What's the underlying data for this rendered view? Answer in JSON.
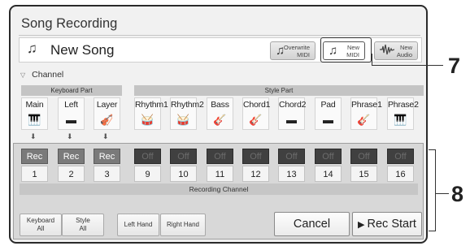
{
  "window": {
    "title": "Song Recording"
  },
  "song": {
    "note_icon": "♫",
    "name": "New Song"
  },
  "mode_buttons": [
    {
      "name": "overwrite-midi-button",
      "icon": "♫",
      "label_line1": "Overwrite",
      "label_line2": "MIDI",
      "selected": false
    },
    {
      "name": "new-midi-button",
      "icon": "♫",
      "label_line1": "New",
      "label_line2": "MIDI",
      "selected": true
    },
    {
      "name": "new-audio-button",
      "icon": "waveform-icon",
      "label_line1": "New",
      "label_line2": "Audio",
      "selected": false
    }
  ],
  "channel": {
    "toggle_icon": "▽",
    "label": "Channel"
  },
  "groups": {
    "keyboard_part": "Keyboard Part",
    "style_part": "Style Part"
  },
  "parts": [
    {
      "name": "Main",
      "icon": "grand-piano-icon",
      "glyph": "🎹"
    },
    {
      "name": "Left",
      "icon": "keyboard-icon",
      "glyph": "▬"
    },
    {
      "name": "Layer",
      "icon": "violin-icon",
      "glyph": "🎻"
    },
    {
      "name": "Rhythm1",
      "icon": "drums-icon",
      "glyph": "🥁"
    },
    {
      "name": "Rhythm2",
      "icon": "drums-icon",
      "glyph": "🥁"
    },
    {
      "name": "Bass",
      "icon": "bass-guitar-icon",
      "glyph": "🎸"
    },
    {
      "name": "Chord1",
      "icon": "guitar-icon",
      "glyph": "🎸"
    },
    {
      "name": "Chord2",
      "icon": "keyboard-icon",
      "glyph": "▬"
    },
    {
      "name": "Pad",
      "icon": "keyboard-icon",
      "glyph": "▬"
    },
    {
      "name": "Phrase1",
      "icon": "guitar-icon",
      "glyph": "🎸"
    },
    {
      "name": "Phrase2",
      "icon": "grand-piano-icon",
      "glyph": "🎹"
    }
  ],
  "arrow_glyph": "⬇",
  "channels": [
    {
      "status": "Rec",
      "number": "1"
    },
    {
      "status": "Rec",
      "number": "2"
    },
    {
      "status": "Rec",
      "number": "3"
    },
    {
      "status": "Off",
      "number": "9"
    },
    {
      "status": "Off",
      "number": "10"
    },
    {
      "status": "Off",
      "number": "11"
    },
    {
      "status": "Off",
      "number": "12"
    },
    {
      "status": "Off",
      "number": "13"
    },
    {
      "status": "Off",
      "number": "14"
    },
    {
      "status": "Off",
      "number": "15"
    },
    {
      "status": "Off",
      "number": "16"
    }
  ],
  "recording_channel_label": "Recording Channel",
  "bottom": {
    "keyboard_all_line1": "Keyboard",
    "keyboard_all_line2": "All",
    "style_all_line1": "Style",
    "style_all_line2": "All",
    "left_hand": "Left Hand",
    "right_hand": "Right Hand",
    "cancel": "Cancel",
    "rec_start_icon": "▶",
    "rec_start": "Rec Start"
  },
  "callouts": {
    "seven": "7",
    "eight": "8"
  },
  "colors": {
    "rec_on": "#7a7a7a",
    "rec_off": "#404040",
    "panel": "#f1f1f1"
  }
}
